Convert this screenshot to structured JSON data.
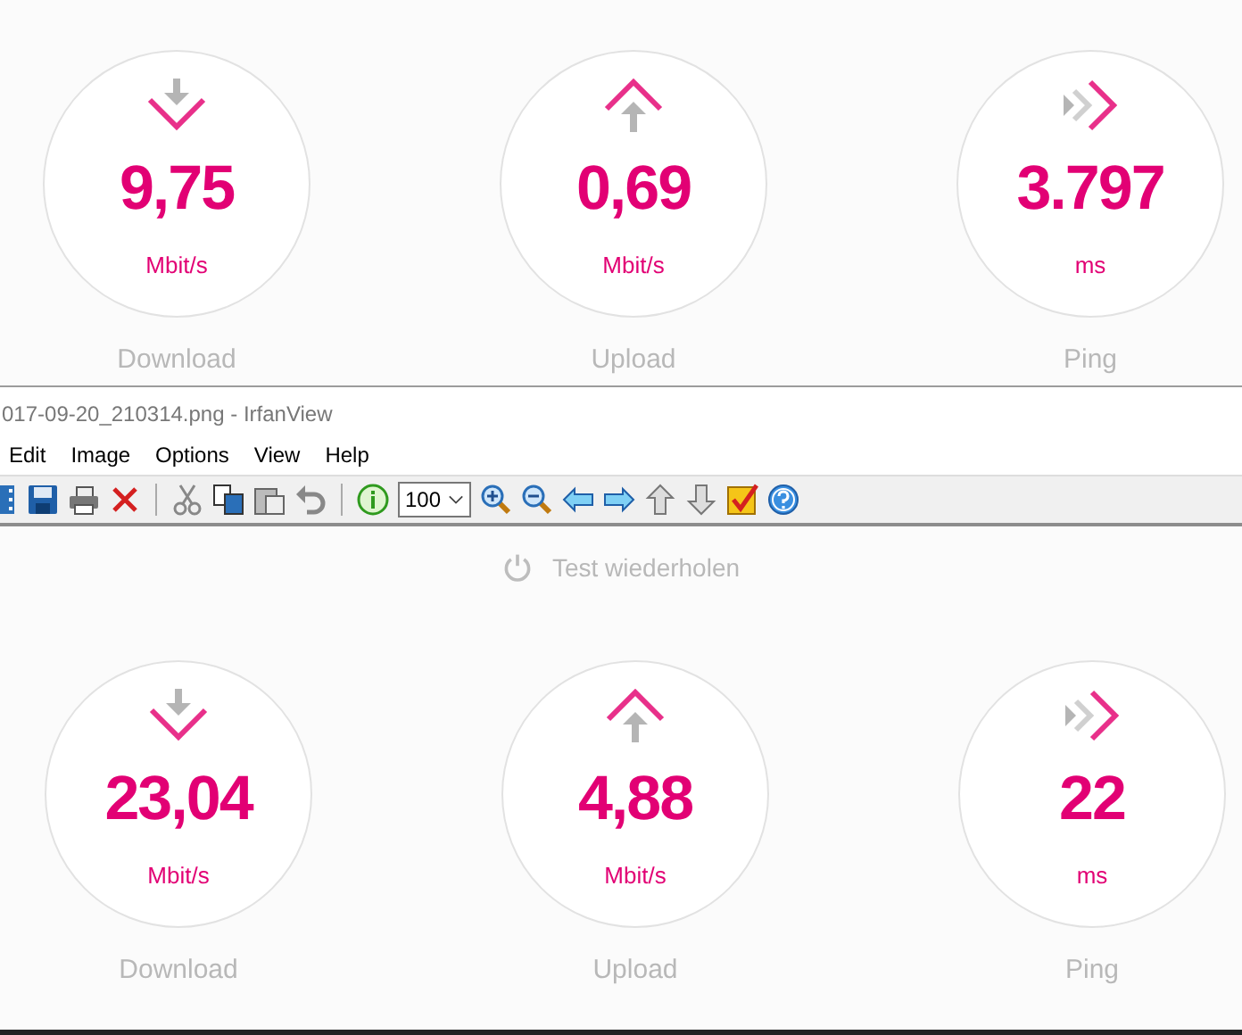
{
  "top_results": [
    {
      "kind": "download",
      "value": "9,75",
      "unit": "Mbit/s",
      "label": "Download"
    },
    {
      "kind": "upload",
      "value": "0,69",
      "unit": "Mbit/s",
      "label": "Upload"
    },
    {
      "kind": "ping",
      "value": "3.797",
      "unit": "ms",
      "label": "Ping"
    }
  ],
  "irfanview": {
    "title": "017-09-20_210314.png - IrfanView",
    "menu": [
      "Edit",
      "Image",
      "Options",
      "View",
      "Help"
    ],
    "zoom": "100"
  },
  "retest": {
    "label": "Test wiederholen"
  },
  "bottom_results": [
    {
      "kind": "download",
      "value": "23,04",
      "unit": "Mbit/s",
      "label": "Download"
    },
    {
      "kind": "upload",
      "value": "4,88",
      "unit": "Mbit/s",
      "label": "Upload"
    },
    {
      "kind": "ping",
      "value": "22",
      "unit": "ms",
      "label": "Ping"
    }
  ]
}
